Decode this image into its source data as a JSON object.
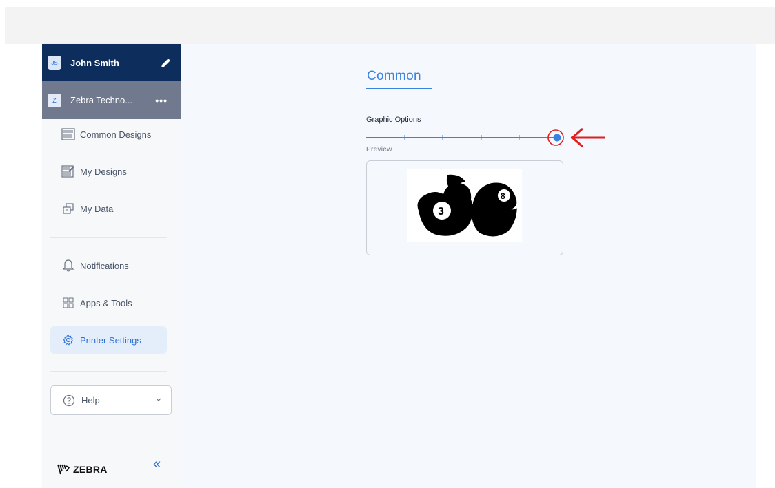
{
  "user": {
    "initials": "JS",
    "name": "John Smith"
  },
  "org": {
    "initials": "Z",
    "name": "Zebra Techno..."
  },
  "nav": {
    "common_designs": "Common Designs",
    "my_designs": "My Designs",
    "my_data": "My Data",
    "notifications": "Notifications",
    "apps_tools": "Apps & Tools",
    "printer_settings": "Printer Settings"
  },
  "help": {
    "label": "Help"
  },
  "logo": {
    "text": "ZEBRA"
  },
  "main": {
    "tab": "Common",
    "graphic_options_label": "Graphic Options",
    "preview_label": "Preview",
    "slider": {
      "steps": 5,
      "value_step": 5
    }
  },
  "colors": {
    "accent": "#3b82e0",
    "sidebar_header": "#0d2d5c",
    "org_row": "#70798d",
    "annotation": "#e02020"
  }
}
